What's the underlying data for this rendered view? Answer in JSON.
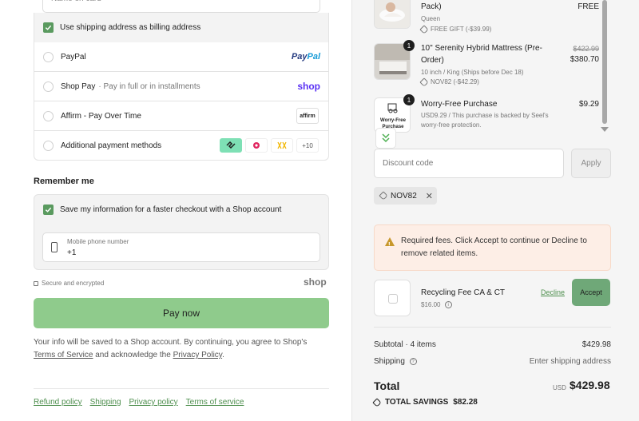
{
  "billing": {
    "name_placeholder": "Name on card",
    "same_as_shipping_label": "Use shipping address as billing address"
  },
  "payment_options": [
    {
      "label": "PayPal",
      "sub": "",
      "logo": "PayPal"
    },
    {
      "label": "Shop Pay",
      "sub": "Pay in full or in installments",
      "logo": "shop"
    },
    {
      "label": "Affirm - Pay Over Time",
      "sub": "",
      "logo": "affirm"
    },
    {
      "label": "Additional payment methods",
      "sub": "",
      "logo": "+10"
    }
  ],
  "remember": {
    "heading": "Remember me",
    "save_label": "Save my information for a faster checkout with a Shop account",
    "phone_label": "Mobile phone number",
    "phone_value": "+1"
  },
  "secure_text": "Secure and encrypted",
  "shop_brand": "shop",
  "pay_now": "Pay now",
  "legal": {
    "pre": "Your info will be saved to a Shop account. By continuing, you agree to Shop's",
    "terms": "Terms of Service",
    "mid": "and acknowledge the",
    "privacy": "Privacy Policy",
    "post": "."
  },
  "footer_links": [
    "Refund policy",
    "Shipping",
    "Privacy policy",
    "Terms of service"
  ],
  "cart": {
    "items": [
      {
        "title": "Pack)",
        "variant": "Queen",
        "discount": "FREE GIFT (-$39.99)",
        "price": "FREE",
        "qty": ""
      },
      {
        "title_line1": "10\" Serenity Hybrid Mattress (Pre-",
        "title_line2": "Order)",
        "variant": "10 inch / King (Ships before Dec 18)",
        "discount": "NOV82 (-$42.29)",
        "price_original": "$422.99",
        "price": "$380.70",
        "qty": "1"
      },
      {
        "title": "Worry-Free Purchase",
        "sub_line1": "USD9.29 / This purchase is backed by Seel's",
        "sub_line2": "worry-free protection.",
        "price": "$9.29",
        "qty": "1",
        "thumb_line1": "Worry-Free",
        "thumb_line2": "Purchase"
      }
    ],
    "discount_placeholder": "Discount code",
    "apply_label": "Apply",
    "applied_code": "NOV82",
    "fees_notice": "Required fees. Click Accept to continue or Decline to remove related items.",
    "fee_item": {
      "title": "Recycling Fee CA & CT",
      "price": "$16.00",
      "decline": "Decline",
      "accept": "Accept"
    },
    "subtotal_label": "Subtotal · 4 items",
    "subtotal_value": "$429.98",
    "shipping_label": "Shipping",
    "shipping_value": "Enter shipping address",
    "total_label": "Total",
    "currency": "USD",
    "total_value": "$429.98",
    "savings_label": "TOTAL SAVINGS",
    "savings_value": "$82.28"
  },
  "colors": {
    "accent": "#5a9a5f",
    "pay_button": "#8fcb8c",
    "fees_bg": "#fdeee6"
  }
}
